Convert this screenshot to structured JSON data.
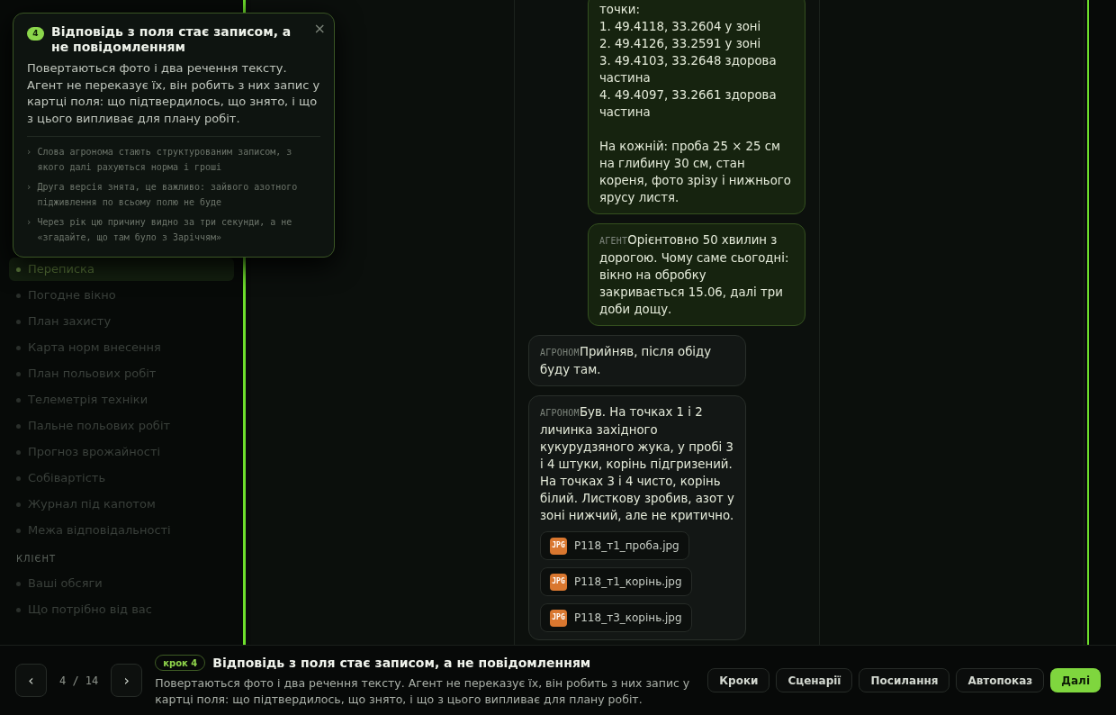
{
  "sidebar": {
    "items": [
      {
        "label": "Переписка",
        "selected": true
      },
      {
        "label": "Погодне вікно",
        "selected": false
      },
      {
        "label": "План захисту",
        "selected": false
      },
      {
        "label": "Карта норм внесення",
        "selected": false
      },
      {
        "label": "План польових робіт",
        "selected": false
      },
      {
        "label": "Телеметрія техніки",
        "selected": false
      },
      {
        "label": "Пальне польових робіт",
        "selected": false
      },
      {
        "label": "Прогноз врожайності",
        "selected": false
      },
      {
        "label": "Собівартість",
        "selected": false
      },
      {
        "label": "Журнал під капотом",
        "selected": false
      },
      {
        "label": "Межа відповідальності",
        "selected": false
      }
    ],
    "section": {
      "title": "КЛІЄНТ",
      "items": [
        {
          "label": "Ваші обсяги",
          "selected": false
        },
        {
          "label": "Що потрібно від вас",
          "selected": false
        }
      ]
    }
  },
  "chat": {
    "messages": [
      {
        "kind": "agent",
        "text": "точки:\n1. 49.4118, 33.2604 у зоні\n2. 49.4126, 33.2591 у зоні\n3. 49.4103, 33.2648 здорова частина\n4. 49.4097, 33.2661 здорова частина\n\nНа кожній: проба 25 × 25 см на глибину 30 см, стан кореня, фото зрізу і нижнього ярусу листя."
      },
      {
        "kind": "agent",
        "sender": "АГЕНТ",
        "text": "Орієнтовно 50 хвилин з дорогою. Чому саме сьогодні: вікно на обробку закривається 15.06, далі три доби дощу."
      },
      {
        "kind": "agronomist",
        "sender": "АГРОНОМ",
        "text": "Прийняв, після обіду буду там."
      },
      {
        "kind": "agronomist",
        "sender": "АГРОНОМ",
        "text": "Був. На точках 1 і 2 личинка західного кукурудзяного жука, у пробі 3 і 4 штуки, корінь підгризений. На точках 3 і 4 чисто, корінь білий. Листкову зробив, азот у зоні нижчий, але не критично.",
        "attachments": [
          {
            "type": "JPG",
            "name": "P118_т1_проба.jpg"
          },
          {
            "type": "JPG",
            "name": "P118_т1_корінь.jpg"
          },
          {
            "type": "JPG",
            "name": "P118_т3_корінь.jpg"
          }
        ]
      }
    ]
  },
  "popup": {
    "badge": "4",
    "title": "Відповідь з поля стає записом, а не повідомленням",
    "close": "×",
    "bullet": "›",
    "body": "Повертаються фото і два речення тексту. Агент не переказує їх, він робить з них запис у картці поля: що підтвердилось, що знято, і що з цього випливає для плану робіт.",
    "points": [
      "Слова агронома стають структурованим записом, з якого далі рахуються норма і гроші",
      "Друга версія знята, це важливо: зайвого азотного підживлення по всьому полю не буде",
      "Через рік цю причину видно за три секунди, а не «згадайте, що там було з Заріччям»"
    ]
  },
  "footer": {
    "prev": "‹",
    "counter": "4 / 14",
    "next": "›",
    "step": "крок 4",
    "title": "Відповідь з поля стає записом, а не повідомленням",
    "description": "Повертаються фото і два речення тексту. Агент не переказує їх, він робить з них запис у картці поля: що підтвердилось, що знято, і що з цього випливає для плану робіт.",
    "buttons": [
      {
        "label": "Кроки",
        "primary": false
      },
      {
        "label": "Сценарії",
        "primary": false
      },
      {
        "label": "Посилання",
        "primary": false
      },
      {
        "label": "Автопоказ",
        "primary": false
      },
      {
        "label": "Далі",
        "primary": true
      }
    ]
  }
}
